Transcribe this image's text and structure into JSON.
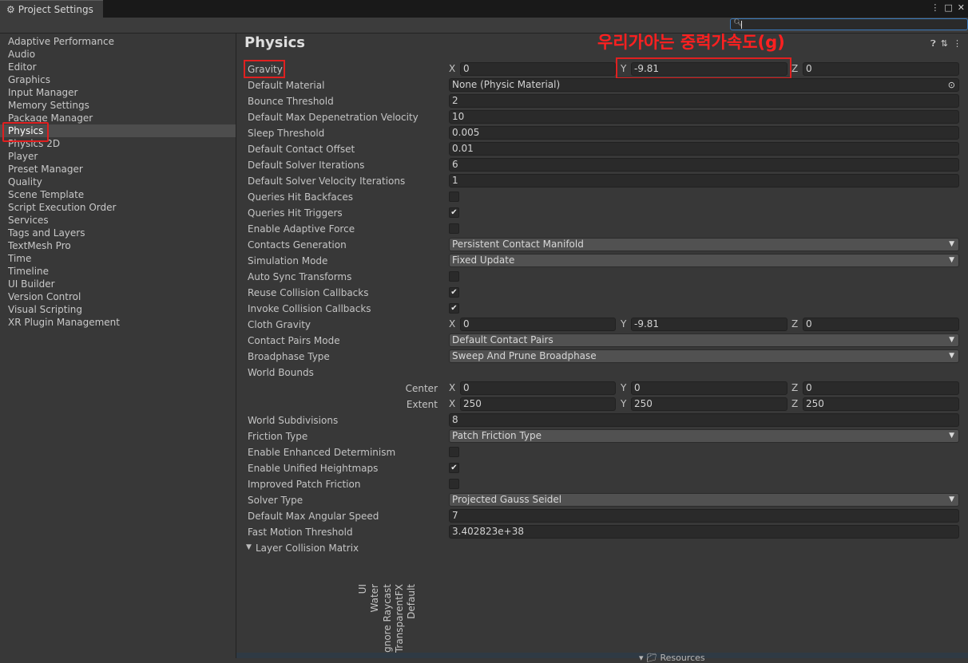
{
  "window": {
    "tab_title": "Project Settings"
  },
  "sidebar": {
    "items": [
      "Adaptive Performance",
      "Audio",
      "Editor",
      "Graphics",
      "Input Manager",
      "Memory Settings",
      "Package Manager",
      "Physics",
      "Physics 2D",
      "Player",
      "Preset Manager",
      "Quality",
      "Scene Template",
      "Script Execution Order",
      "Services",
      "Tags and Layers",
      "TextMesh Pro",
      "Time",
      "Timeline",
      "UI Builder",
      "Version Control",
      "Visual Scripting",
      "XR Plugin Management"
    ],
    "selected": "Physics"
  },
  "annotation": "우리가아는 중력가속도(g)",
  "page": {
    "title": "Physics",
    "axes": {
      "x": "X",
      "y": "Y",
      "z": "Z"
    },
    "gravity": {
      "label": "Gravity",
      "x": "0",
      "y": "-9.81",
      "z": "0"
    },
    "default_material": {
      "label": "Default Material",
      "value": "None (Physic Material)"
    },
    "bounce_threshold": {
      "label": "Bounce Threshold",
      "value": "2"
    },
    "max_depenetration": {
      "label": "Default Max Depenetration Velocity",
      "value": "10"
    },
    "sleep_threshold": {
      "label": "Sleep Threshold",
      "value": "0.005"
    },
    "contact_offset": {
      "label": "Default Contact Offset",
      "value": "0.01"
    },
    "solver_iterations": {
      "label": "Default Solver Iterations",
      "value": "6"
    },
    "solver_velocity_iterations": {
      "label": "Default Solver Velocity Iterations",
      "value": "1"
    },
    "queries_hit_backfaces": {
      "label": "Queries Hit Backfaces",
      "checked": false
    },
    "queries_hit_triggers": {
      "label": "Queries Hit Triggers",
      "checked": true
    },
    "adaptive_force": {
      "label": "Enable Adaptive Force",
      "checked": false
    },
    "contacts_generation": {
      "label": "Contacts Generation",
      "value": "Persistent Contact Manifold"
    },
    "simulation_mode": {
      "label": "Simulation Mode",
      "value": "Fixed Update"
    },
    "auto_sync": {
      "label": "Auto Sync Transforms",
      "checked": false
    },
    "reuse_callbacks": {
      "label": "Reuse Collision Callbacks",
      "checked": true
    },
    "invoke_callbacks": {
      "label": "Invoke Collision Callbacks",
      "checked": true
    },
    "cloth_gravity": {
      "label": "Cloth Gravity",
      "x": "0",
      "y": "-9.81",
      "z": "0"
    },
    "contact_pairs_mode": {
      "label": "Contact Pairs Mode",
      "value": "Default Contact Pairs"
    },
    "broadphase_type": {
      "label": "Broadphase Type",
      "value": "Sweep And Prune Broadphase"
    },
    "world_bounds": {
      "label": "World Bounds",
      "center": {
        "label": "Center",
        "x": "0",
        "y": "0",
        "z": "0"
      },
      "extent": {
        "label": "Extent",
        "x": "250",
        "y": "250",
        "z": "250"
      }
    },
    "world_subdivisions": {
      "label": "World Subdivisions",
      "value": "8"
    },
    "friction_type": {
      "label": "Friction Type",
      "value": "Patch Friction Type"
    },
    "enhanced_determinism": {
      "label": "Enable Enhanced Determinism",
      "checked": false
    },
    "unified_heightmaps": {
      "label": "Enable Unified Heightmaps",
      "checked": true
    },
    "improved_patch_friction": {
      "label": "Improved Patch Friction",
      "checked": false
    },
    "solver_type": {
      "label": "Solver Type",
      "value": "Projected Gauss Seidel"
    },
    "max_angular_speed": {
      "label": "Default Max Angular Speed",
      "value": "7"
    },
    "fast_motion_threshold": {
      "label": "Fast Motion Threshold",
      "value": "3.402823e+38"
    },
    "layer_collision_matrix": {
      "label": "Layer Collision Matrix",
      "layers": [
        "Default",
        "TransparentFX",
        "Ignore Raycast",
        "Water",
        "UI"
      ]
    }
  },
  "footer": {
    "resources": "Resources"
  },
  "colors": {
    "highlight": "#e02020",
    "background": "#383838",
    "field": "#2a2a2a",
    "selected": "#4d4d4d"
  }
}
